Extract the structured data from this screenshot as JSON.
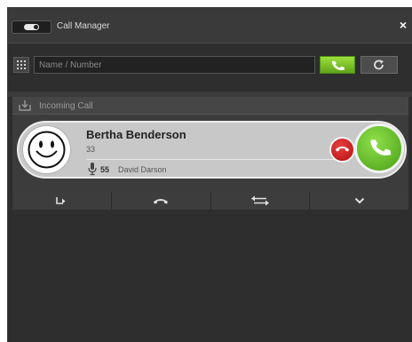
{
  "window": {
    "title": "Call Manager",
    "close_label": "×"
  },
  "search": {
    "placeholder": "Name / Number",
    "value": ""
  },
  "incoming": {
    "header_label": "Incoming Call",
    "caller_name": "Bertha Benderson",
    "caller_number": "33",
    "extension_number": "55",
    "extension_name": "David Darson"
  },
  "actions": [
    {
      "icon": "forward-icon"
    },
    {
      "icon": "hangup-icon"
    },
    {
      "icon": "transfer-icon"
    },
    {
      "icon": "chevron-down-icon"
    }
  ],
  "colors": {
    "background": "#2e2e2e",
    "accept_green": "#5ea61a",
    "decline_red": "#c41a1a",
    "card": "#c8c8c8"
  }
}
